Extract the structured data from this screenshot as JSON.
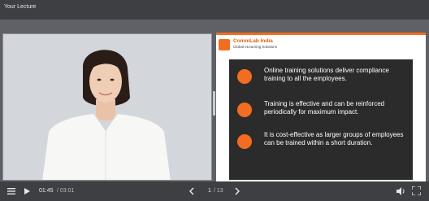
{
  "window": {
    "title": "Your Lecture"
  },
  "slide": {
    "brand_name": "CommLab India",
    "brand_tagline": "Global eLearning Solutions",
    "bullets": [
      "Online training solutions deliver compliance training to all the employees.",
      "Training is effective and can be reinforced periodically for maximum impact.",
      "It is cost-effective as larger groups of employees can be trained within a short duration."
    ],
    "accent_color": "#f26d21"
  },
  "player": {
    "current_time": "01:45",
    "total_time": "/ 03:01",
    "current_slide": "1",
    "total_slides": "/ 13"
  }
}
